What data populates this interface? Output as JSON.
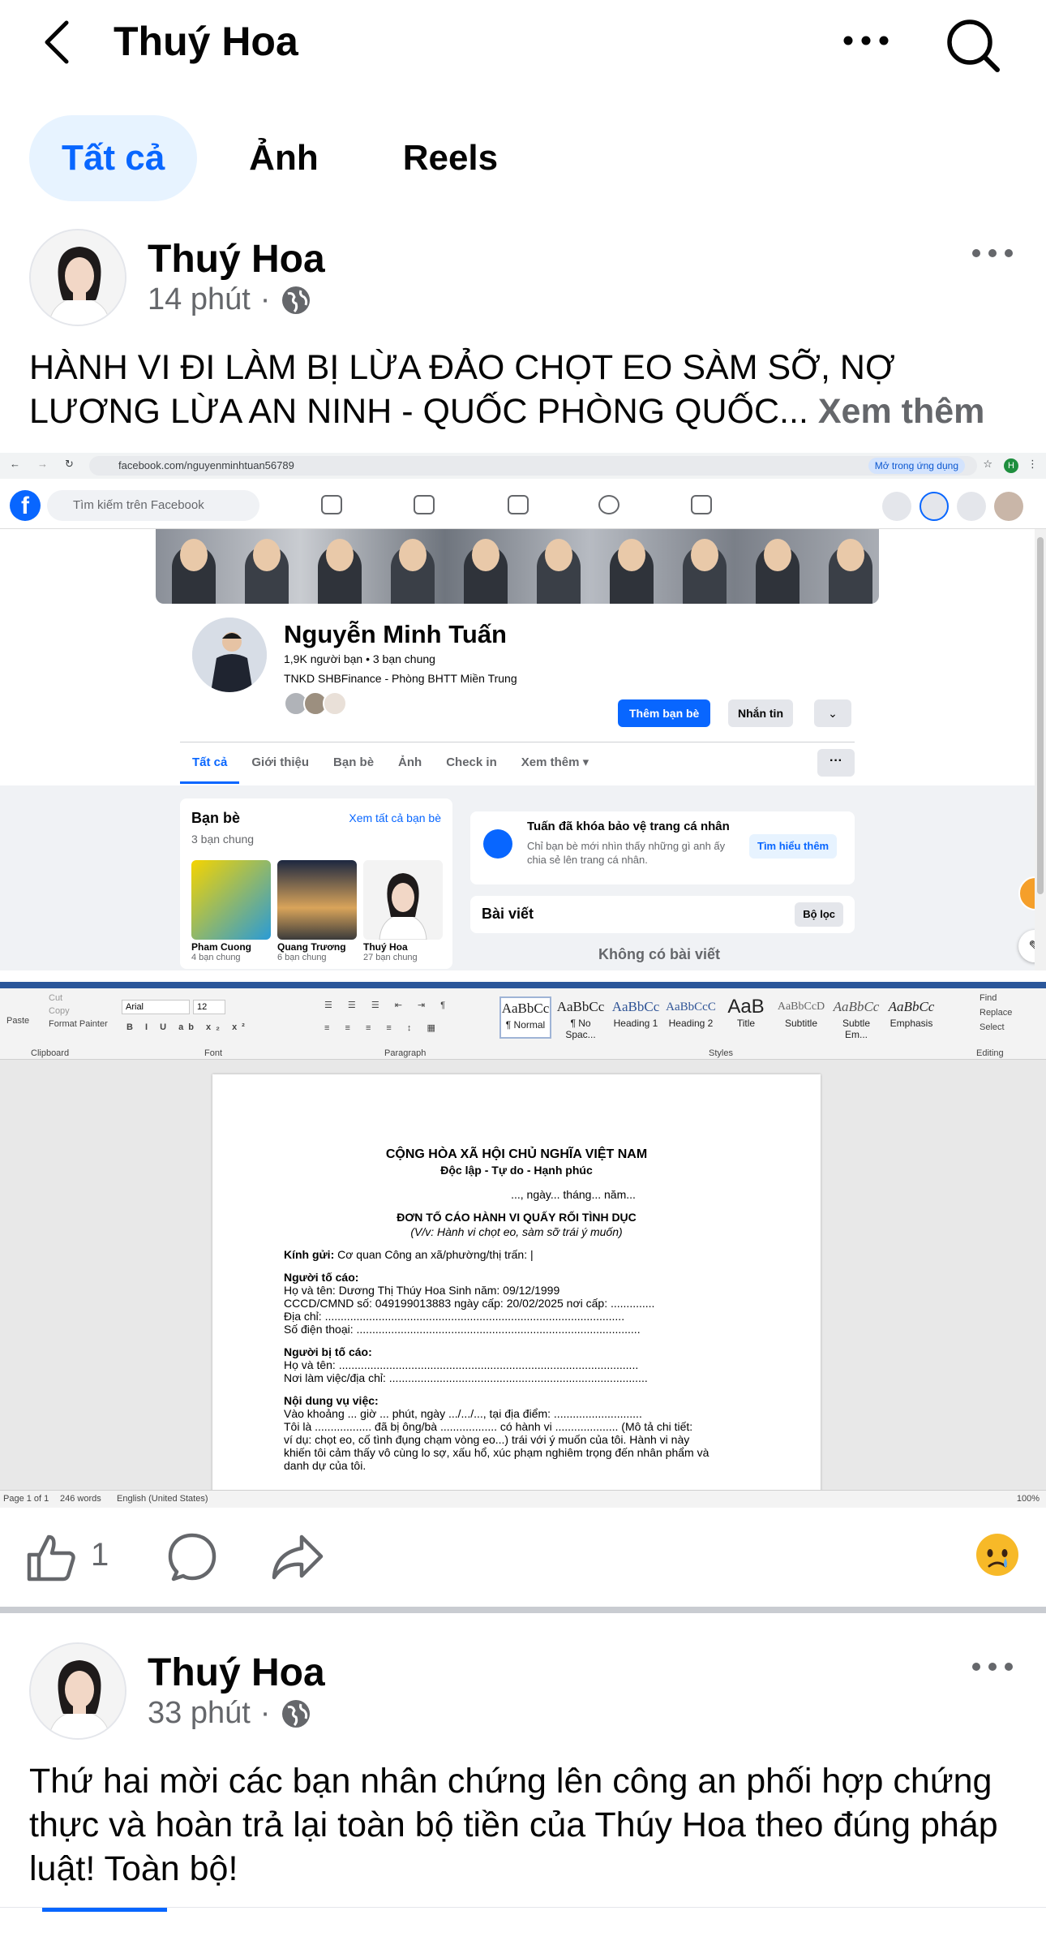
{
  "header": {
    "title": "Thuý Hoa"
  },
  "tabs": [
    {
      "label": "Tất cả",
      "active": true
    },
    {
      "label": "Ảnh",
      "active": false
    },
    {
      "label": "Reels",
      "active": false
    }
  ],
  "post1": {
    "author": "Thuý Hoa",
    "time": "14 phút",
    "separator": "·",
    "text": "HÀNH VI ĐI LÀM BỊ LỪA ĐẢO CHỌT EO SÀM SỠ, NỢ LƯƠNG LỪA AN NINH - QUỐC PHÒNG QUỐC...",
    "see_more": "Xem thêm",
    "like_count": "1"
  },
  "browser": {
    "url": "facebook.com/nguyenminhtuan56789",
    "open_in_app": "Mở trong ứng dụng",
    "search_placeholder": "Tìm kiếm trên Facebook"
  },
  "fb_profile": {
    "name": "Nguyễn Minh Tuấn",
    "friends": "1,9K người bạn • 3 bạn chung",
    "work": "TNKD SHBFinance - Phòng BHTT Miền Trung",
    "add_friend": "Thêm bạn bè",
    "message": "Nhắn tin",
    "tabs": [
      "Tất cả",
      "Giới thiệu",
      "Bạn bè",
      "Ảnh",
      "Check in",
      "Xem thêm ▾"
    ],
    "friends_card": {
      "title": "Bạn bè",
      "see_all": "Xem tất cả bạn bè",
      "mutual": "3 bạn chung",
      "people": [
        {
          "name": "Pham Cuong",
          "mutual": "4 bạn chung"
        },
        {
          "name": "Quang Trương",
          "mutual": "6 bạn chung"
        },
        {
          "name": "Thuý Hoa",
          "mutual": "27 bạn chung"
        }
      ]
    },
    "lock": {
      "title": "Tuấn đã khóa bảo vệ trang cá nhân",
      "desc": "Chỉ bạn bè mới nhìn thấy những gì anh ấy chia sẻ lên trang cá nhân.",
      "button": "Tìm hiểu thêm"
    },
    "posts_title": "Bài viết",
    "filter": "Bộ lọc",
    "no_posts": "Không có bài viết"
  },
  "word": {
    "clipboard": {
      "paste": "Paste",
      "cut": "Cut",
      "copy": "Copy",
      "format_painter": "Format Painter",
      "label": "Clipboard"
    },
    "font": {
      "name": "Arial",
      "size": "12",
      "label": "Font"
    },
    "paragraph_label": "Paragraph",
    "styles_label": "Styles",
    "editing_label": "Editing",
    "editing": {
      "find": "Find",
      "replace": "Replace",
      "select": "Select"
    },
    "styles": [
      {
        "preview": "AaBbCc",
        "name": "¶ Normal"
      },
      {
        "preview": "AaBbCc",
        "name": "¶ No Spac..."
      },
      {
        "preview": "AaBbCc",
        "name": "Heading 1"
      },
      {
        "preview": "AaBbCcC",
        "name": "Heading 2"
      },
      {
        "preview": "AaB",
        "name": "Title"
      },
      {
        "preview": "AaBbCcD",
        "name": "Subtitle"
      },
      {
        "preview": "AaBbCc",
        "name": "Subtle Em..."
      },
      {
        "preview": "AaBbCc",
        "name": "Emphasis"
      }
    ],
    "doc": {
      "nation": "CỘNG HÒA XÃ HỘI CHỦ NGHĨA VIỆT NAM",
      "motto": "Độc lập - Tự do - Hạnh phúc",
      "date": "..., ngày... tháng... năm...",
      "title": "ĐƠN TỐ CÁO HÀNH VI QUẤY RỐI TÌNH DỤC",
      "subtitle": "(V/v: Hành vi chọt eo, sàm sỡ trái ý muốn)",
      "to_label": "Kính gửi:",
      "to_value": "Cơ quan Công an xã/phường/thị trấn: |",
      "accuser_label": "Người tố cáo:",
      "accuser_name": "Họ và tên: Dương Thị Thúy Hoa                  Sinh năm: 09/12/1999",
      "accuser_id": "CCCD/CMND số: 049199013883 ngày cấp: 20/02/2025 nơi cấp: ..............",
      "accuser_addr": "Địa chỉ: ...............................................................................................",
      "accuser_phone": "Số điện thoại: ..........................................................................................",
      "accused_label": "Người bị tố cáo:",
      "accused_name": "Họ và tên: ...............................................................................................",
      "accused_work": "Nơi làm việc/địa chỉ: ..................................................................................",
      "case_label": "Nội dung vụ việc:",
      "case_1": "Vào khoảng ... giờ ... phút, ngày .../.../..., tại địa điểm: ............................",
      "case_2": "Tôi là .................. đã bị ông/bà .................. có hành vi .................... (Mô tả chi tiết:",
      "case_3": "ví dụ: chọt eo, cố tình đụng chạm vòng eo...) trái với ý muốn của tôi. Hành vi này",
      "case_4": "khiến tôi cảm thấy vô cùng lo sợ, xấu hổ, xúc phạm nghiêm trọng đến nhân phẩm và",
      "case_5": "danh dự của tôi."
    },
    "status": {
      "page": "Page 1 of 1",
      "words": "246 words",
      "lang": "English (United States)",
      "zoom": "100%"
    }
  },
  "post2": {
    "author": "Thuý Hoa",
    "time": "33 phút",
    "separator": "·",
    "text": "Thứ hai mời các bạn nhân chứng lên công an phối hợp chứng thực và hoàn trả lại toàn bộ tiền của Thúy Hoa theo đúng pháp luật! Toàn bộ!"
  },
  "colors": {
    "accent": "#0866ff",
    "tab_active_bg": "#e7f3ff",
    "secondary_text": "#65676b"
  }
}
